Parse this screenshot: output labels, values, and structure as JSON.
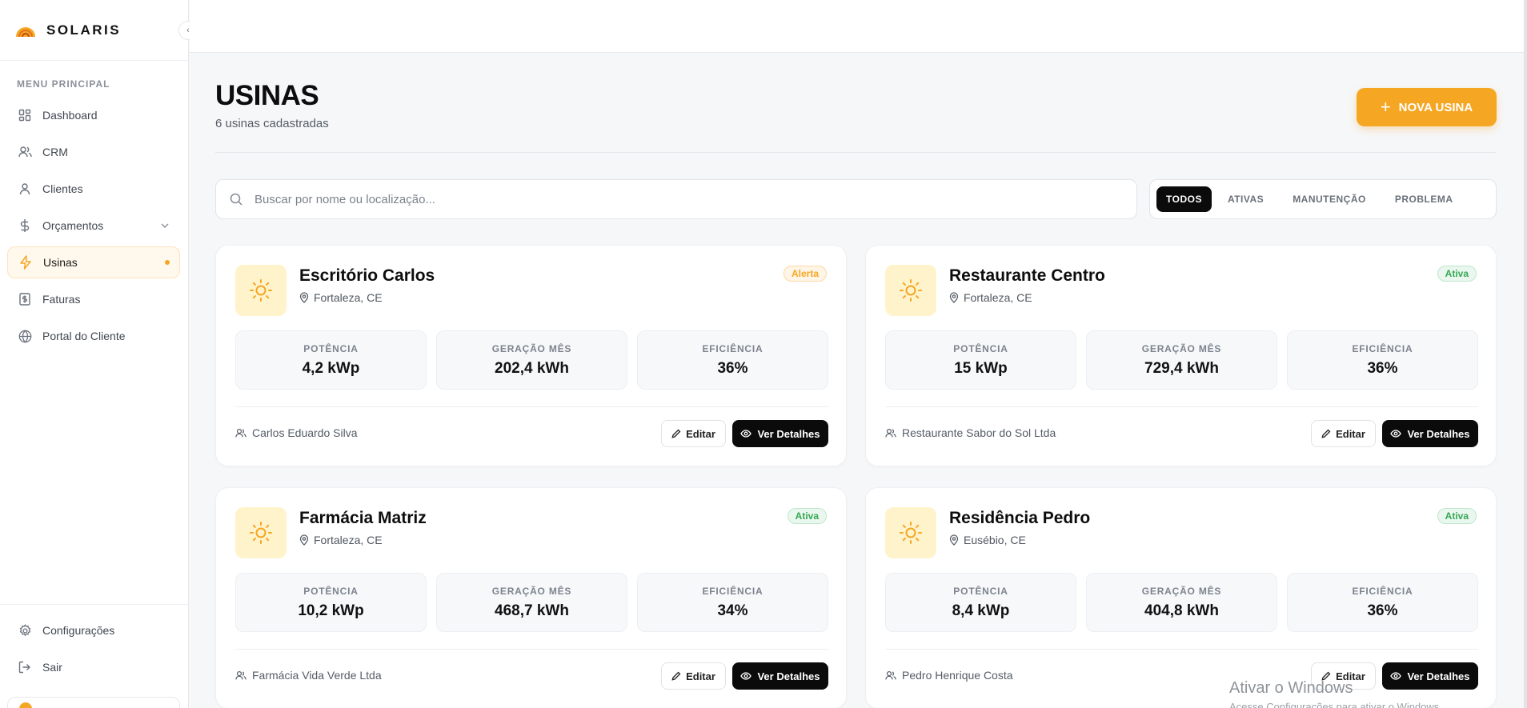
{
  "brand": {
    "name": "SOLARIS"
  },
  "sidebar": {
    "menu_title": "MENU PRINCIPAL",
    "items": [
      {
        "label": "Dashboard",
        "icon": "dashboard-icon"
      },
      {
        "label": "CRM",
        "icon": "users-icon"
      },
      {
        "label": "Clientes",
        "icon": "user-icon"
      },
      {
        "label": "Orçamentos",
        "icon": "dollar-icon"
      },
      {
        "label": "Usinas",
        "icon": "lightning-icon"
      },
      {
        "label": "Faturas",
        "icon": "invoice-icon"
      },
      {
        "label": "Portal do Cliente",
        "icon": "globe-icon"
      }
    ],
    "bottom": [
      {
        "label": "Configurações",
        "icon": "gear-icon"
      },
      {
        "label": "Sair",
        "icon": "logout-icon"
      }
    ]
  },
  "page": {
    "title": "USINAS",
    "subtitle": "6 usinas cadastradas",
    "new_button": "NOVA USINA"
  },
  "search": {
    "placeholder": "Buscar por nome ou localização..."
  },
  "filters": [
    "TODOS",
    "ATIVAS",
    "MANUTENÇÃO",
    "PROBLEMA"
  ],
  "stat_labels": {
    "power": "POTÊNCIA",
    "generation": "GERAÇÃO MÊS",
    "efficiency": "EFICIÊNCIA"
  },
  "actions": {
    "edit": "Editar",
    "details": "Ver Detalhes"
  },
  "cards": [
    {
      "name": "Escritório Carlos",
      "location": "Fortaleza, CE",
      "status": "Alerta",
      "power": "4,2 kWp",
      "generation": "202,4 kWh",
      "efficiency": "36%",
      "owner": "Carlos Eduardo Silva"
    },
    {
      "name": "Restaurante Centro",
      "location": "Fortaleza, CE",
      "status": "Ativa",
      "power": "15 kWp",
      "generation": "729,4 kWh",
      "efficiency": "36%",
      "owner": "Restaurante Sabor do Sol Ltda"
    },
    {
      "name": "Farmácia Matriz",
      "location": "Fortaleza, CE",
      "status": "Ativa",
      "power": "10,2 kWp",
      "generation": "468,7 kWh",
      "efficiency": "34%",
      "owner": "Farmácia Vida Verde Ltda"
    },
    {
      "name": "Residência Pedro",
      "location": "Eusébio, CE",
      "status": "Ativa",
      "power": "8,4 kWp",
      "generation": "404,8 kWh",
      "efficiency": "36%",
      "owner": "Pedro Henrique Costa"
    }
  ],
  "colors": {
    "accent": "#f5a623",
    "dark": "#0b0b0b",
    "success": "#34a853"
  },
  "watermark": {
    "line1": "Ativar o Windows",
    "line2": "Acesse Configurações para ativar o Windows."
  }
}
